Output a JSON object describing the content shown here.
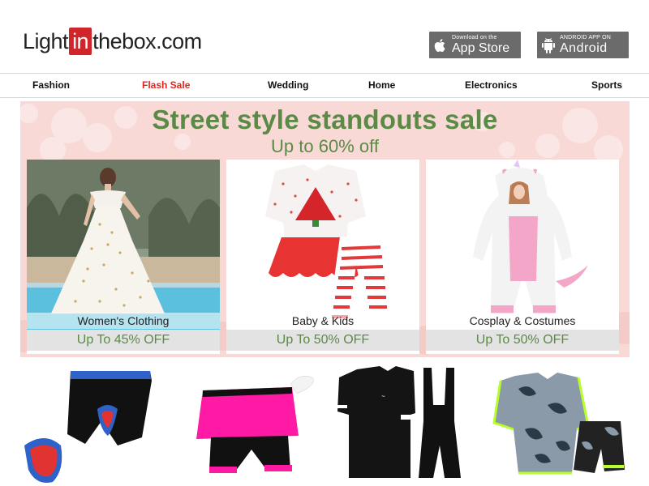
{
  "header": {
    "logo": {
      "pre": "Light",
      "mid": "in",
      "post": "thebox.com"
    },
    "app_store": {
      "small": "Download on the",
      "big": "App Store"
    },
    "android": {
      "small": "ANDROID APP ON",
      "big": "Android"
    }
  },
  "nav": [
    "Fashion",
    "Flash Sale",
    "Wedding",
    "Home",
    "Electronics",
    "Sports"
  ],
  "banner": {
    "title": "Street style standouts sale",
    "subtitle": "Up to 60% off",
    "cards": [
      {
        "label": "Women's Clothing",
        "offer": "Up To 45% OFF"
      },
      {
        "label": "Baby & Kids",
        "offer": "Up To 50% OFF"
      },
      {
        "label": "Cosplay & Costumes",
        "offer": "Up To 50% OFF"
      }
    ]
  },
  "colors": {
    "accent_green": "#5a8a45",
    "flash_red": "#e1251b",
    "logo_red": "#d0262b",
    "banner_pink": "#f8d9d6"
  },
  "products": [
    "padded-cycling-shorts",
    "pink-cycling-skort",
    "black-cycling-jersey-bib-set",
    "camo-cycling-jersey-set"
  ]
}
